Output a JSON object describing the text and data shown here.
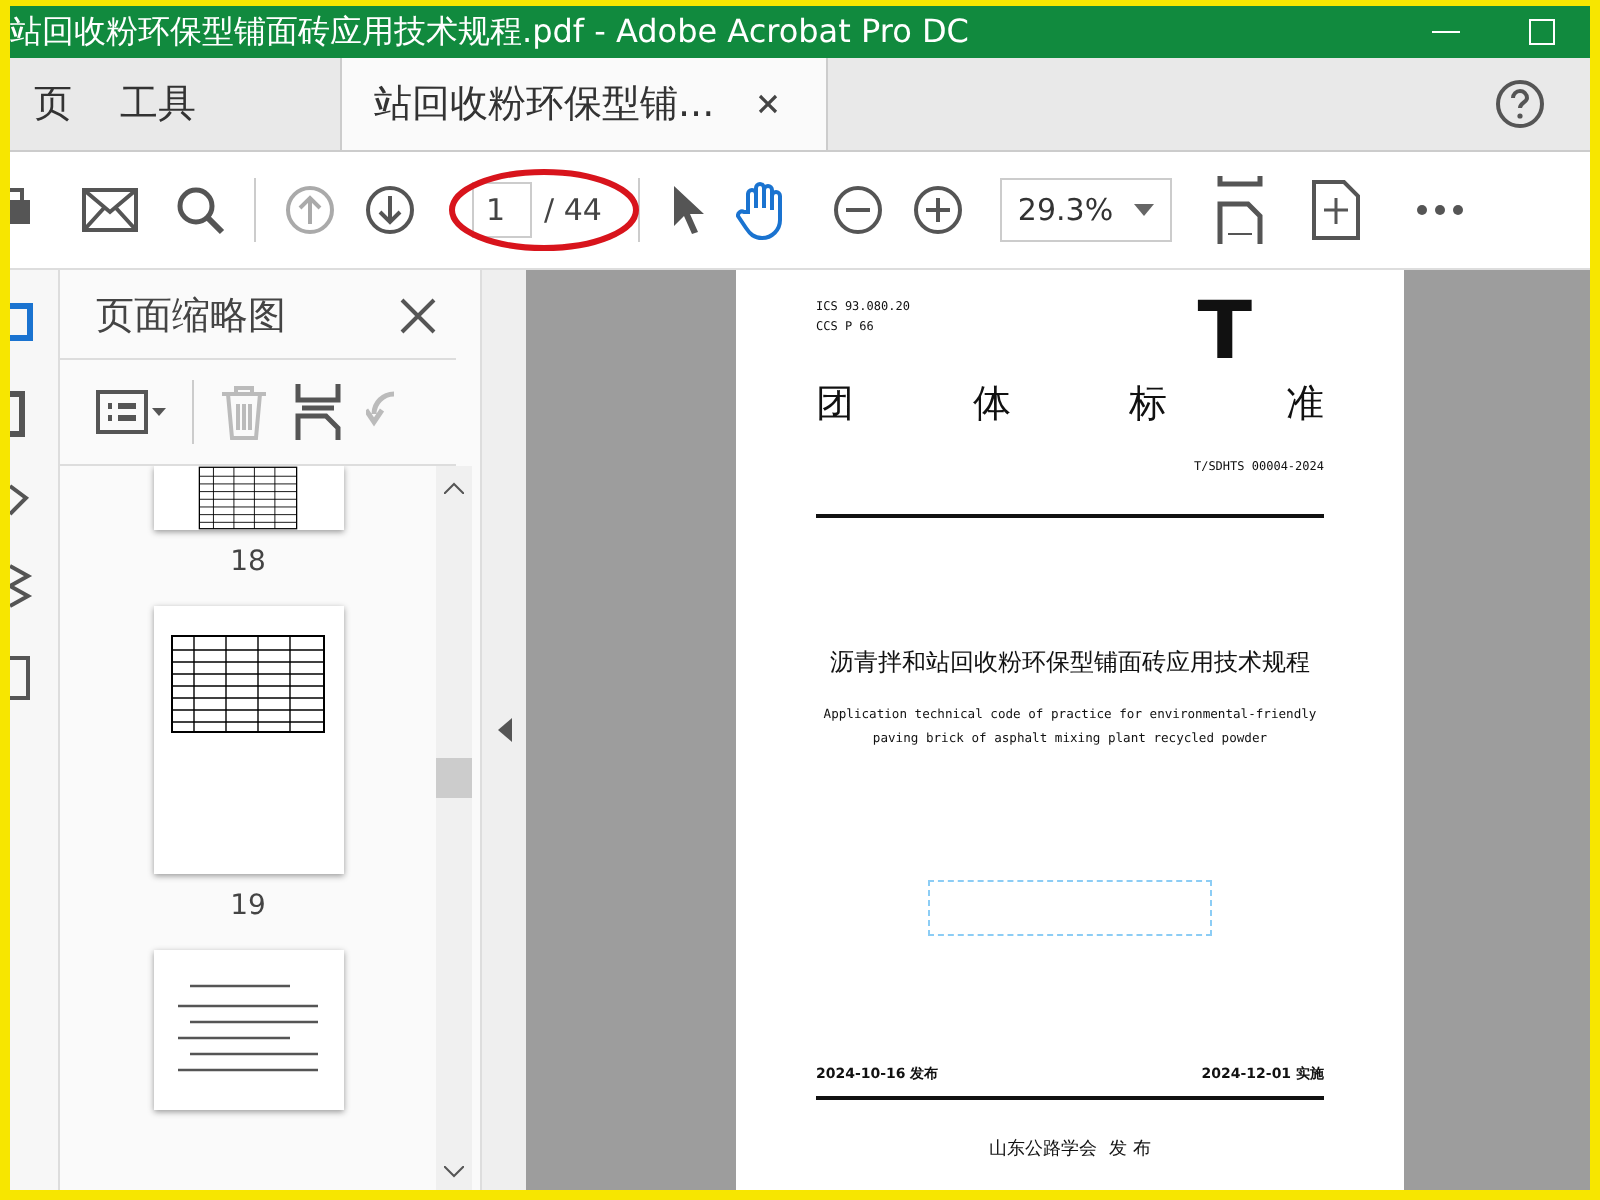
{
  "window": {
    "title": "站回收粉环保型铺面砖应用技术规程.pdf - Adobe Acrobat Pro DC"
  },
  "nav_tabs": [
    {
      "label": "页",
      "selected": false
    },
    {
      "label": "工具",
      "selected": false
    },
    {
      "label": "站回收粉环保型铺...",
      "selected": true
    }
  ],
  "toolbar": {
    "page_current": "1",
    "page_total": "/ 44",
    "zoom": "29.3%",
    "prev_disabled": true
  },
  "thumbnails_panel": {
    "title": "页面缩略图",
    "thumbnails": [
      {
        "label": "18",
        "kind": "table"
      },
      {
        "label": "19",
        "kind": "table"
      },
      {
        "kind": "text"
      }
    ]
  },
  "document": {
    "ics": "ICS 93.080.20",
    "ccs": "CCS P 66",
    "mark": "T",
    "category": [
      "团",
      "体",
      "标",
      "准"
    ],
    "code": "T/SDHTS 00004-2024",
    "title": "沥青拌和站回收粉环保型铺面砖应用技术规程",
    "subtitle_en": [
      "Application technical code of practice for environmental-friendly",
      "paving brick of asphalt mixing plant recycled powder"
    ],
    "issue_date": "2024-10-16 发布",
    "effective_date": "2024-12-01 实施",
    "publisher": "山东公路学会  发 布"
  }
}
